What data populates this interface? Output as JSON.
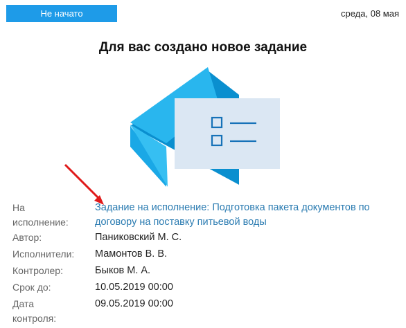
{
  "status": "Не начато",
  "date": "среда, 08 мая",
  "title": "Для вас создано новое задание",
  "task": {
    "label_line1": "На",
    "label_line2": "исполнение:",
    "link_text": "Задание на исполнение: Подготовка пакета документов по договору на поставку питьевой воды"
  },
  "fields": [
    {
      "label": "Автор:",
      "value": "Паниковский М. С."
    },
    {
      "label": "Исполнители:",
      "value": "Мамонтов В. В."
    },
    {
      "label": "Контролер:",
      "value": "Быков М. А."
    },
    {
      "label": "Срок до:",
      "value": "10.05.2019 00:00"
    }
  ],
  "control_date": {
    "label_line1": "Дата",
    "label_line2": "контроля:",
    "value": "09.05.2019 00:00"
  },
  "colors": {
    "accent": "#1e9be8",
    "link": "#2a7bb1",
    "arrow": "#e01b1b"
  }
}
